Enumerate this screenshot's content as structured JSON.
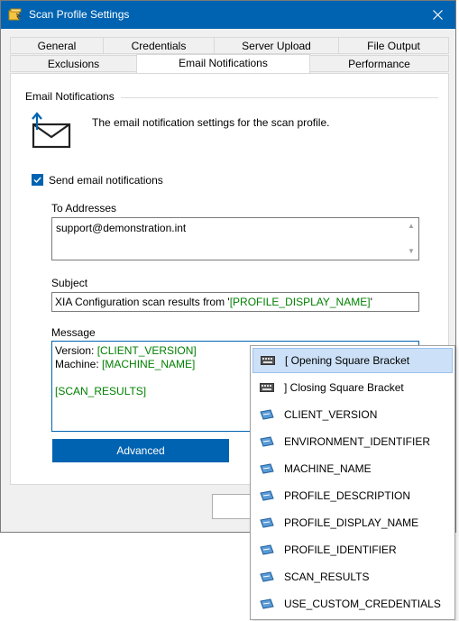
{
  "window": {
    "title": "Scan Profile Settings"
  },
  "tabs_row1": [
    "General",
    "Credentials",
    "Server Upload",
    "File Output"
  ],
  "tabs_row2": [
    "Exclusions",
    "Email Notifications",
    "Performance"
  ],
  "active_tab": "Email Notifications",
  "group": {
    "label": "Email Notifications",
    "description": "The email notification settings for the scan profile."
  },
  "send_checkbox": {
    "label": "Send email notifications",
    "checked": true
  },
  "to": {
    "label": "To Addresses",
    "value": "support@demonstration.int"
  },
  "subject": {
    "label": "Subject",
    "prefix": "XIA Configuration scan results from '",
    "token": "[PROFILE_DISPLAY_NAME]",
    "suffix": "'"
  },
  "message": {
    "label": "Message",
    "line1_prefix": "Version: ",
    "line1_token": "[CLIENT_VERSION]",
    "line2_prefix": "Machine: ",
    "line2_token": "[MACHINE_NAME]",
    "line4_token": "[SCAN_RESULTS]"
  },
  "advanced_button": "Advanced",
  "menu": {
    "items": [
      {
        "label": "[ Opening Square Bracket",
        "icon": "keyboard-icon",
        "selected": true
      },
      {
        "label": "] Closing Square Bracket",
        "icon": "keyboard-icon",
        "selected": false
      },
      {
        "label": "CLIENT_VERSION",
        "icon": "variable-icon",
        "selected": false
      },
      {
        "label": "ENVIRONMENT_IDENTIFIER",
        "icon": "variable-icon",
        "selected": false
      },
      {
        "label": "MACHINE_NAME",
        "icon": "variable-icon",
        "selected": false
      },
      {
        "label": "PROFILE_DESCRIPTION",
        "icon": "variable-icon",
        "selected": false
      },
      {
        "label": "PROFILE_DISPLAY_NAME",
        "icon": "variable-icon",
        "selected": false
      },
      {
        "label": "PROFILE_IDENTIFIER",
        "icon": "variable-icon",
        "selected": false
      },
      {
        "label": "SCAN_RESULTS",
        "icon": "variable-icon",
        "selected": false
      },
      {
        "label": "USE_CUSTOM_CREDENTIALS",
        "icon": "variable-icon",
        "selected": false
      }
    ]
  },
  "colors": {
    "accent": "#0063b1",
    "token": "#008000",
    "selection": "#cce0f7"
  }
}
